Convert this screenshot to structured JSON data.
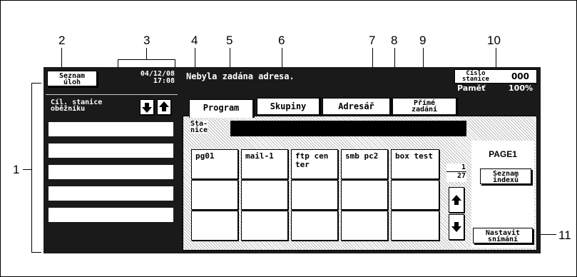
{
  "callouts": {
    "n1": "1",
    "n2": "2",
    "n3": "3",
    "n4": "4",
    "n5": "5",
    "n6": "6",
    "n7": "7",
    "n8": "8",
    "n9": "9",
    "n10": "10",
    "n11": "11"
  },
  "left_panel": {
    "job_list_label_1": "Seznam",
    "job_list_label_2": "úloh",
    "date": "04/12/08",
    "time": "17:08",
    "broadcast_label_1": "Cíl. stanice",
    "broadcast_label_2": "oběžníku",
    "destination_slots": [
      "",
      "",
      "",
      "",
      ""
    ]
  },
  "header": {
    "message": "Nebyla zadána adresa.",
    "station_label_1": "Číslo",
    "station_label_2": "stanice",
    "station_number": "000",
    "memory_label": "Paměť",
    "memory_value": "100%"
  },
  "tabs": {
    "program": "Program",
    "groups": "Skupiny",
    "address_book": "Adresář",
    "direct_1": "Přímé",
    "direct_2": "zadání"
  },
  "station": {
    "label_1": "Sta-",
    "label_2": "nice",
    "value": ""
  },
  "programs": {
    "p1": "pg01",
    "p2": "mail-1",
    "p3a": "ftp cen",
    "p3b": "ter",
    "p4": "smb pc2",
    "p5": "box test"
  },
  "paging": {
    "page_label": "PAGE1",
    "current": "1",
    "total": "27",
    "index_1": "Seznam",
    "index_2": "indexů",
    "scan_1": "Nastavit",
    "scan_2": "snímání"
  },
  "colors": {
    "screen_bg": "#1a1a1a",
    "dark_field": "#000000"
  }
}
